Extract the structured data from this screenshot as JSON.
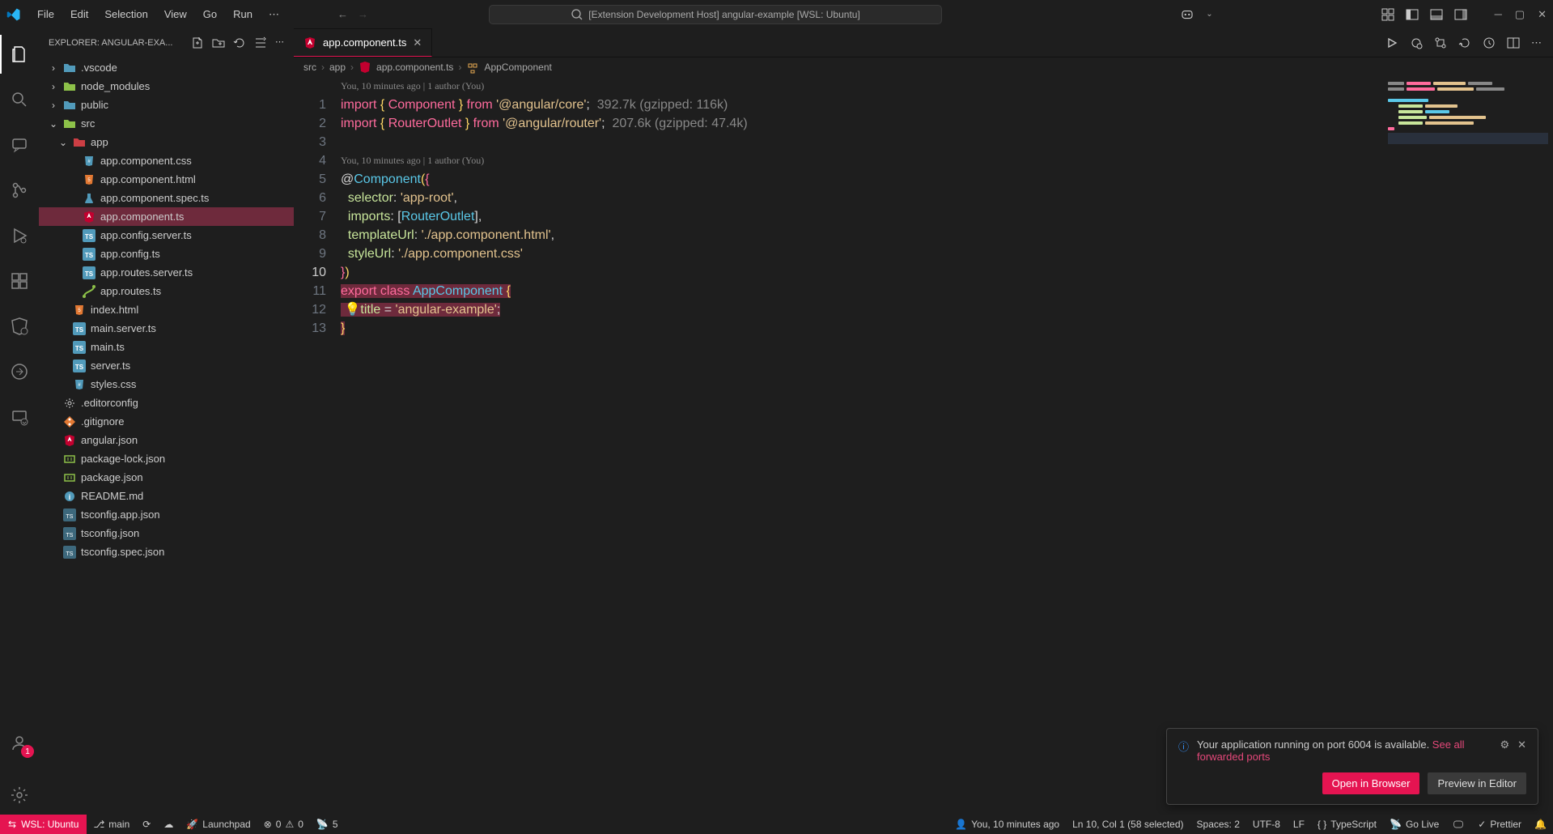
{
  "titlebar": {
    "menu": [
      "File",
      "Edit",
      "Selection",
      "View",
      "Go",
      "Run"
    ],
    "search_placeholder": "[Extension Development Host] angular-example [WSL: Ubuntu]"
  },
  "sidebar": {
    "header": "EXPLORER: ANGULAR-EXA...",
    "tree": [
      {
        "indent": 0,
        "chev": "›",
        "icon": "folder",
        "color": "#519aba",
        "label": ".vscode"
      },
      {
        "indent": 0,
        "chev": "›",
        "icon": "folder",
        "color": "#8dc149",
        "label": "node_modules"
      },
      {
        "indent": 0,
        "chev": "›",
        "icon": "folder",
        "color": "#519aba",
        "label": "public"
      },
      {
        "indent": 0,
        "chev": "⌄",
        "icon": "folder",
        "color": "#8dc149",
        "label": "src"
      },
      {
        "indent": 1,
        "chev": "⌄",
        "icon": "folder",
        "color": "#cc3e44",
        "label": "app"
      },
      {
        "indent": 2,
        "chev": "",
        "icon": "css",
        "color": "#519aba",
        "label": "app.component.css"
      },
      {
        "indent": 2,
        "chev": "",
        "icon": "html",
        "color": "#e37933",
        "label": "app.component.html"
      },
      {
        "indent": 2,
        "chev": "",
        "icon": "spec",
        "color": "#519aba",
        "label": "app.component.spec.ts"
      },
      {
        "indent": 2,
        "chev": "",
        "icon": "ng",
        "color": "#c3002f",
        "label": "app.component.ts",
        "selected": true
      },
      {
        "indent": 2,
        "chev": "",
        "icon": "ts",
        "color": "#519aba",
        "label": "app.config.server.ts"
      },
      {
        "indent": 2,
        "chev": "",
        "icon": "ts",
        "color": "#519aba",
        "label": "app.config.ts"
      },
      {
        "indent": 2,
        "chev": "",
        "icon": "ts",
        "color": "#519aba",
        "label": "app.routes.server.ts"
      },
      {
        "indent": 2,
        "chev": "",
        "icon": "route",
        "color": "#8dc149",
        "label": "app.routes.ts"
      },
      {
        "indent": 1,
        "chev": "",
        "icon": "html",
        "color": "#e37933",
        "label": "index.html"
      },
      {
        "indent": 1,
        "chev": "",
        "icon": "ts",
        "color": "#519aba",
        "label": "main.server.ts"
      },
      {
        "indent": 1,
        "chev": "",
        "icon": "ts",
        "color": "#519aba",
        "label": "main.ts"
      },
      {
        "indent": 1,
        "chev": "",
        "icon": "ts",
        "color": "#519aba",
        "label": "server.ts"
      },
      {
        "indent": 1,
        "chev": "",
        "icon": "css",
        "color": "#519aba",
        "label": "styles.css"
      },
      {
        "indent": 0,
        "chev": "",
        "icon": "conf",
        "color": "#d4d4d4",
        "label": ".editorconfig"
      },
      {
        "indent": 0,
        "chev": "",
        "icon": "git",
        "color": "#e37933",
        "label": ".gitignore"
      },
      {
        "indent": 0,
        "chev": "",
        "icon": "ng",
        "color": "#c3002f",
        "label": "angular.json"
      },
      {
        "indent": 0,
        "chev": "",
        "icon": "npm",
        "color": "#8dc149",
        "label": "package-lock.json"
      },
      {
        "indent": 0,
        "chev": "",
        "icon": "npm",
        "color": "#8dc149",
        "label": "package.json"
      },
      {
        "indent": 0,
        "chev": "",
        "icon": "info",
        "color": "#519aba",
        "label": "README.md"
      },
      {
        "indent": 0,
        "chev": "",
        "icon": "tsc",
        "color": "#aaa",
        "label": "tsconfig.app.json"
      },
      {
        "indent": 0,
        "chev": "",
        "icon": "tsc",
        "color": "#aaa",
        "label": "tsconfig.json"
      },
      {
        "indent": 0,
        "chev": "",
        "icon": "tsc",
        "color": "#aaa",
        "label": "tsconfig.spec.json"
      }
    ]
  },
  "tab": {
    "filename": "app.component.ts"
  },
  "breadcrumb": [
    "src",
    "app",
    "app.component.ts",
    "AppComponent"
  ],
  "codelens1": "You, 10 minutes ago | 1 author (You)",
  "codelens2": "You, 10 minutes ago | 1 author (You)",
  "code": {
    "lines": [
      1,
      2,
      3,
      4,
      5,
      6,
      7,
      8,
      9,
      10,
      11,
      12,
      13
    ],
    "hint1": "  392.7k (gzipped: 116k)",
    "hint2": "  207.6k (gzipped: 47.4k)",
    "line1": {
      "kw": "import",
      "br": "{",
      "comp": "Component",
      "br2": "}",
      "fr": "from",
      "str": "'@angular/core'",
      "sc": ";"
    },
    "line2": {
      "kw": "import",
      "br": "{",
      "comp": "RouterOutlet",
      "br2": "}",
      "fr": "from",
      "str": "'@angular/router'",
      "sc": ";"
    },
    "line4a": "@",
    "line4b": "Component",
    "line4c": "(",
    "line4d": "{",
    "line5a": "selector",
    "line5b": ": ",
    "line5c": "'app-root'",
    "line5d": ",",
    "line6a": "imports",
    "line6b": ": [",
    "line6c": "RouterOutlet",
    "line6d": "],",
    "line7a": "templateUrl",
    "line7b": ": ",
    "line7c": "'./app.component.html'",
    "line7d": ",",
    "line8a": "styleUrl",
    "line8b": ": ",
    "line8c": "'./app.component.css'",
    "line9a": "}",
    "line9b": ")",
    "line10a": "export",
    "line10b": "class",
    "line10c": "AppComponent",
    "line10d": "{",
    "line11a": "title",
    "line11b": " = ",
    "line11c": "'angular-example'",
    "line11d": ";",
    "line12": "}"
  },
  "notification": {
    "text": "Your application running on port 6004 is available. ",
    "link": "See all forwarded ports",
    "btn1": "Open in Browser",
    "btn2": "Preview in Editor"
  },
  "status": {
    "remote": "WSL: Ubuntu",
    "branch": "main",
    "launchpad": "Launchpad",
    "errors": "0",
    "warnings": "0",
    "ports": "5",
    "blame": "You, 10 minutes ago",
    "pos": "Ln 10, Col 1 (58 selected)",
    "spaces": "Spaces: 2",
    "encoding": "UTF-8",
    "eol": "LF",
    "lang": "TypeScript",
    "golive": "Go Live",
    "prettier": "Prettier"
  },
  "accounts_badge": "1"
}
